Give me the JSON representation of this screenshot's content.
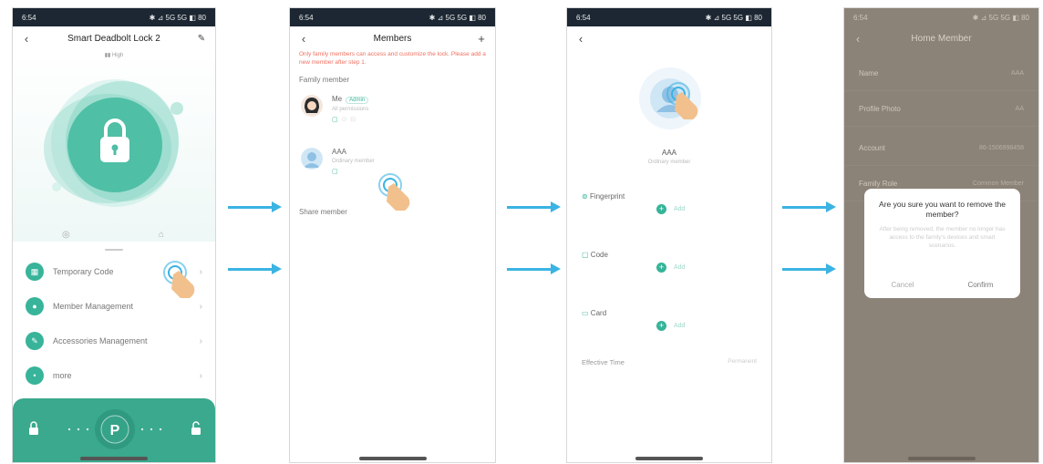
{
  "status": {
    "time": "6:54",
    "icons": "✱ ⊿ 5G 5G ◧ 80"
  },
  "colors": {
    "accent": "#37b49a",
    "arrow": "#3bb3e3",
    "warning": "#f07060",
    "dim_overlay": "#8c8378"
  },
  "screen1": {
    "title": "Smart Deadbolt Lock 2",
    "back_icon": "chevron-left-icon",
    "edit_icon": "pencil-icon",
    "battery": "▮▮ High",
    "menu": [
      {
        "icon": "grid-icon",
        "glyph": "▦",
        "label": "Temporary Code"
      },
      {
        "icon": "user-icon",
        "glyph": "●",
        "label": "Member Management"
      },
      {
        "icon": "wrench-icon",
        "glyph": "✎",
        "label": "Accessories Management"
      },
      {
        "icon": "more-icon",
        "glyph": "•",
        "label": "more"
      }
    ]
  },
  "screen2": {
    "title": "Members",
    "add_icon": "plus-icon",
    "warning": "Only family members can access and customize the lock. Please add a new member after step 1.",
    "family_label": "Family member",
    "members": [
      {
        "name": "Me",
        "badge": "Admin",
        "sub": "All permissions"
      },
      {
        "name": "AAA",
        "badge": "",
        "sub": "Ordinary member"
      }
    ],
    "shared_label": "Share member"
  },
  "screen3": {
    "name": "AAA",
    "sub": "Ordinary member",
    "sections": [
      {
        "icon": "fingerprint-icon",
        "label": "Fingerprint",
        "add": "Add"
      },
      {
        "icon": "keypad-icon",
        "label": "Code",
        "add": "Add"
      },
      {
        "icon": "card-icon",
        "label": "Card",
        "add": "Add"
      }
    ],
    "effective_label": "Effective Time",
    "effective_value": "Permanent"
  },
  "screen4": {
    "title": "Home Member",
    "rows": [
      {
        "label": "Name",
        "value": "AAA"
      },
      {
        "label": "Profile Photo",
        "value": "AA"
      },
      {
        "label": "Account",
        "value": "86-1506998458"
      },
      {
        "label": "Family Role",
        "value": "Common Member"
      }
    ],
    "dialog": {
      "title": "Are you sure you want to remove the member?",
      "message": "After being removed, the member no longer has access to the family's devices and smart scenarios.",
      "cancel": "Cancel",
      "confirm": "Confirm"
    }
  }
}
